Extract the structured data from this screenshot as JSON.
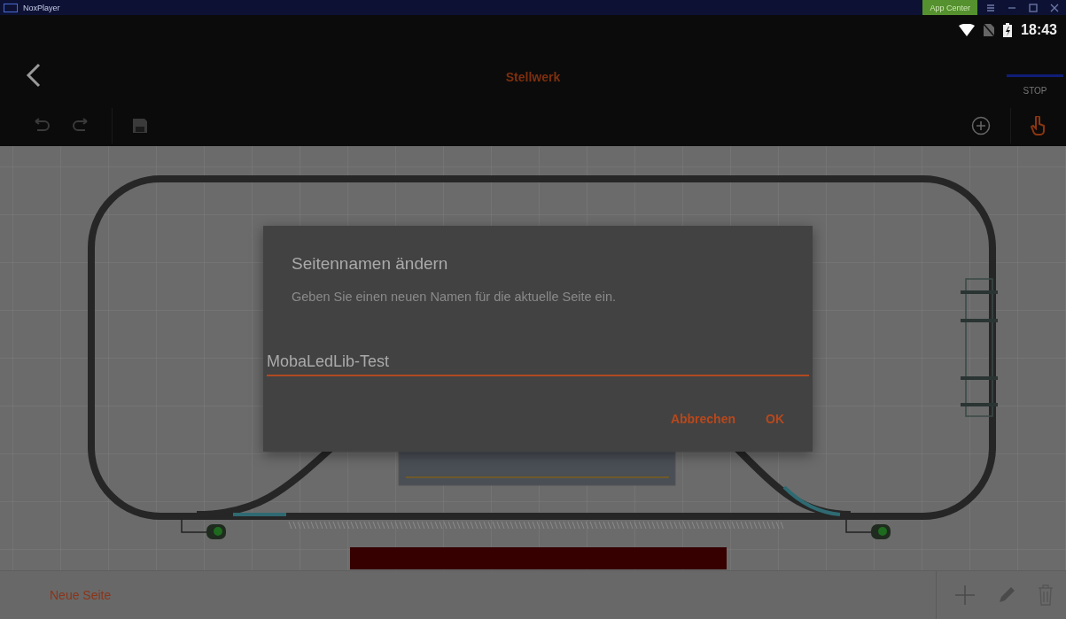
{
  "emulator": {
    "title": "NoxPlayer",
    "app_center_button": "App Center"
  },
  "status_bar": {
    "time": "18:43"
  },
  "app_bar": {
    "title": "Stellwerk",
    "stop_label": "STOP"
  },
  "page_tabs": [
    {
      "label": "Neue Seite",
      "selected": true
    }
  ],
  "dialog": {
    "title": "Seitennamen ändern",
    "message": "Geben Sie einen neuen Namen für die aktuelle Seite ein.",
    "input": {
      "value": "MobaLedLib-Test"
    },
    "buttons": [
      "Abbrechen",
      "OK"
    ]
  }
}
